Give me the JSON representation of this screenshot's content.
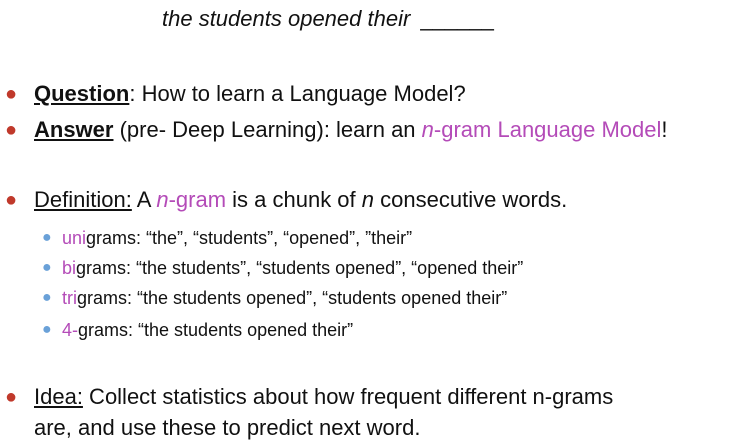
{
  "top": {
    "phrase": "the students opened their",
    "blank": "______"
  },
  "question": {
    "label": "Question",
    "rest": ": How to learn a Language Model?"
  },
  "answer": {
    "label": "Answer",
    "pre": " (pre- Deep Learning): learn an ",
    "n": "n",
    "model": "-gram Language Model",
    "end": "!"
  },
  "definition": {
    "label": "Definition:",
    "a": " A ",
    "n1": "n",
    "gram": "-gram",
    "mid": " is a chunk of ",
    "n2": "n",
    "end": " consecutive words."
  },
  "examples": [
    {
      "prefix": "uni",
      "rest": "grams: “the”, “students”, “opened”, ”their”"
    },
    {
      "prefix": "bi",
      "rest": "grams: “the students”, “students opened”, “opened their”"
    },
    {
      "prefix": "tri",
      "rest": "grams: “the students opened”, “students opened their”"
    },
    {
      "prefix": "4-",
      "rest": "grams: “the students opened their”"
    }
  ],
  "idea": {
    "label": "Idea:",
    "line1": " Collect statistics about how frequent different n-grams",
    "line2": "are, and use these to predict next word."
  },
  "colors": {
    "bullet_main": "#c0392b",
    "bullet_sub": "#6aa1d8",
    "accent": "#b44bb8"
  }
}
